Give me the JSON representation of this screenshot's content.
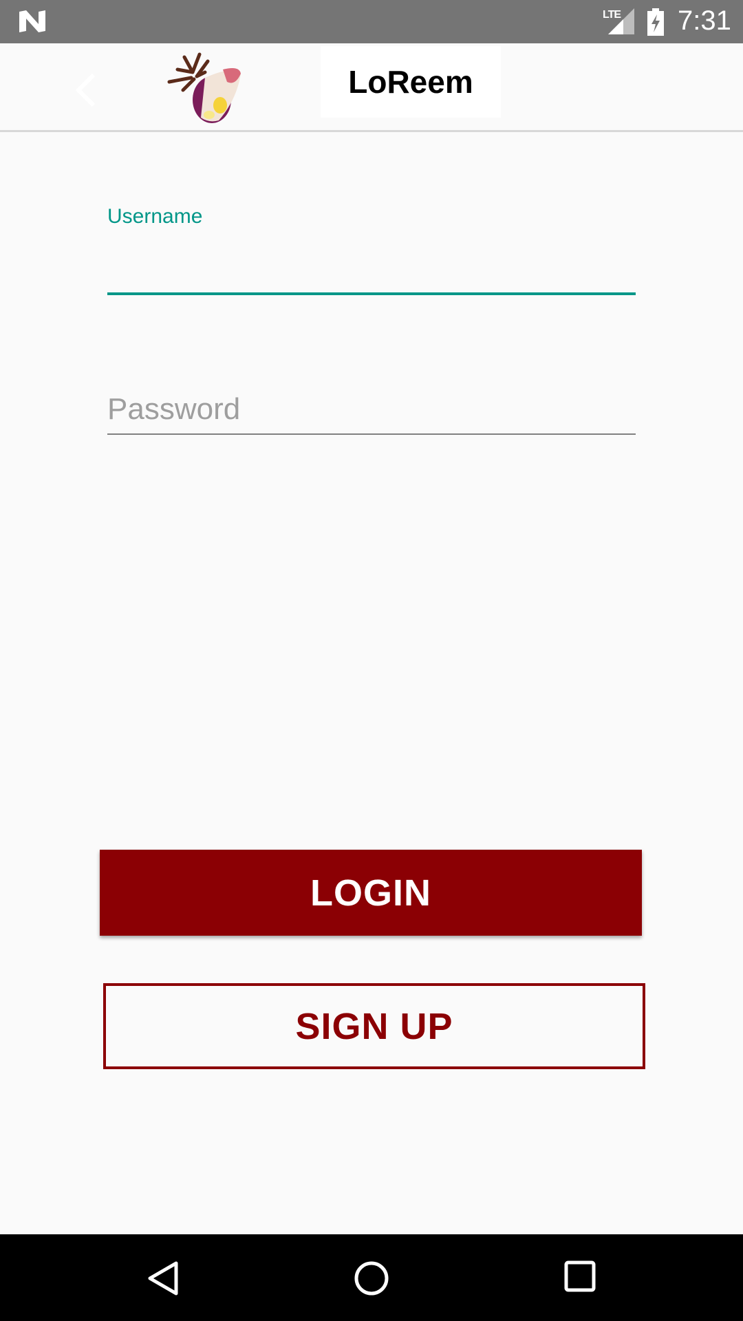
{
  "status_bar": {
    "network": "LTE",
    "time": "7:31"
  },
  "app_bar": {
    "brand": "LoReem",
    "icons": [
      "back-arrow",
      "logo-deer-image"
    ]
  },
  "form": {
    "username_label": "Username",
    "username_value": "",
    "password_placeholder": "Password",
    "accent_color": "#009688"
  },
  "buttons": {
    "login_label": "LOGIN",
    "signup_label": "SIGN UP",
    "primary_color": "#8b0004"
  },
  "nav_bar": {
    "icons": [
      "back-triangle",
      "home-circle",
      "recents-square"
    ]
  }
}
